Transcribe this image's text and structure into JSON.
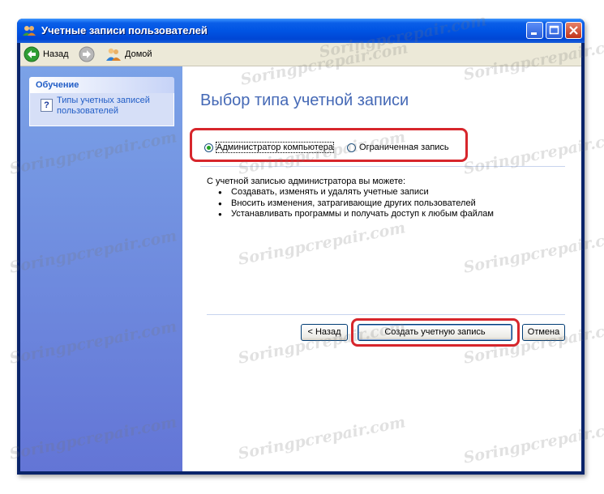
{
  "window": {
    "title": "Учетные записи пользователей"
  },
  "toolbar": {
    "back_label": "Назад",
    "home_label": "Домой"
  },
  "sidebar": {
    "section_title": "Обучение",
    "link": "Типы учетных записей пользователей"
  },
  "main": {
    "title": "Выбор типа учетной записи",
    "account_types": [
      {
        "label": "Администратор компьютера",
        "selected": true
      },
      {
        "label": "Ограниченная запись",
        "selected": false
      }
    ],
    "description": "С учетной записью администратора вы можете:",
    "capabilities": [
      "Создавать, изменять и удалять учетные записи",
      "Вносить изменения, затрагивающие других пользователей",
      "Устанавливать программы и получать доступ к любым файлам"
    ],
    "buttons": {
      "back": "< Назад",
      "create": "Создать учетную запись",
      "cancel": "Отмена"
    }
  },
  "watermark": "Soringpcrepair.com",
  "colors": {
    "titlebar": "#0054e3",
    "sidebar": "#7ba2e7",
    "title_text": "#4569b6",
    "highlight": "#d7262c"
  }
}
